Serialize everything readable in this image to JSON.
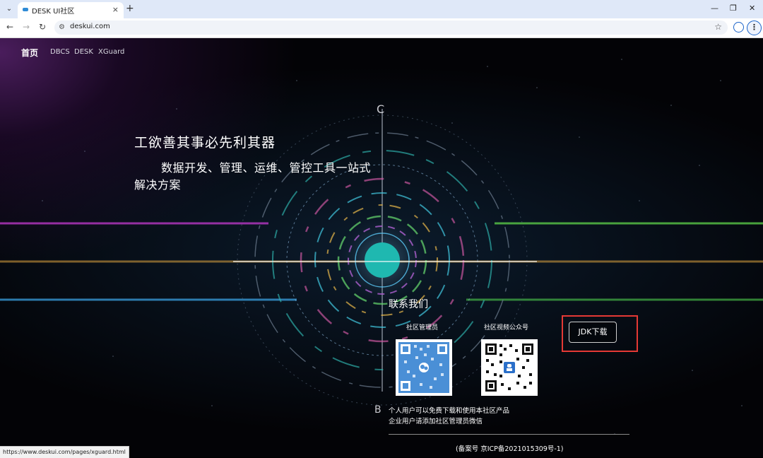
{
  "browser": {
    "tab_title": "DESK UI社区",
    "tab_close": "×",
    "new_tab": "+",
    "tab_menu": "⌄",
    "window_minimize": "—",
    "window_maximize": "❐",
    "window_close": "✕",
    "back": "←",
    "forward": "→",
    "reload": "↻",
    "url": "deskui.com",
    "site_icon": "⚙",
    "bookmark": "☆",
    "menu": "⋮",
    "status_url": "https://www.deskui.com/pages/xguard.html"
  },
  "nav": {
    "home": "首页",
    "items": [
      "DBCS",
      "DESK",
      "XGuard"
    ]
  },
  "hero": {
    "title": "工欲善其事必先利其器",
    "subtitle": "数据开发、管理、运维、管控工具一站式解决方案"
  },
  "contact": {
    "title": "联系我们",
    "qr1_label": "社区管理员",
    "qr2_label": "社区视频公众号"
  },
  "jdk_button": "JDK下载",
  "notes": {
    "line1": "个人用户可以免费下载和使用本社区产品",
    "line2": "企业用户请添加社区管理员微信"
  },
  "footer": {
    "icp": "(备案号  京ICP备2021015309号-1)"
  },
  "colors": {
    "highlight": "#e53935",
    "qr_blue": "#4a8fd6",
    "page_bg": "#030306"
  },
  "icons": [
    "search-icon",
    "back-icon",
    "forward-icon",
    "reload-icon",
    "star-icon",
    "profile-icon",
    "kebab-menu-icon"
  ]
}
